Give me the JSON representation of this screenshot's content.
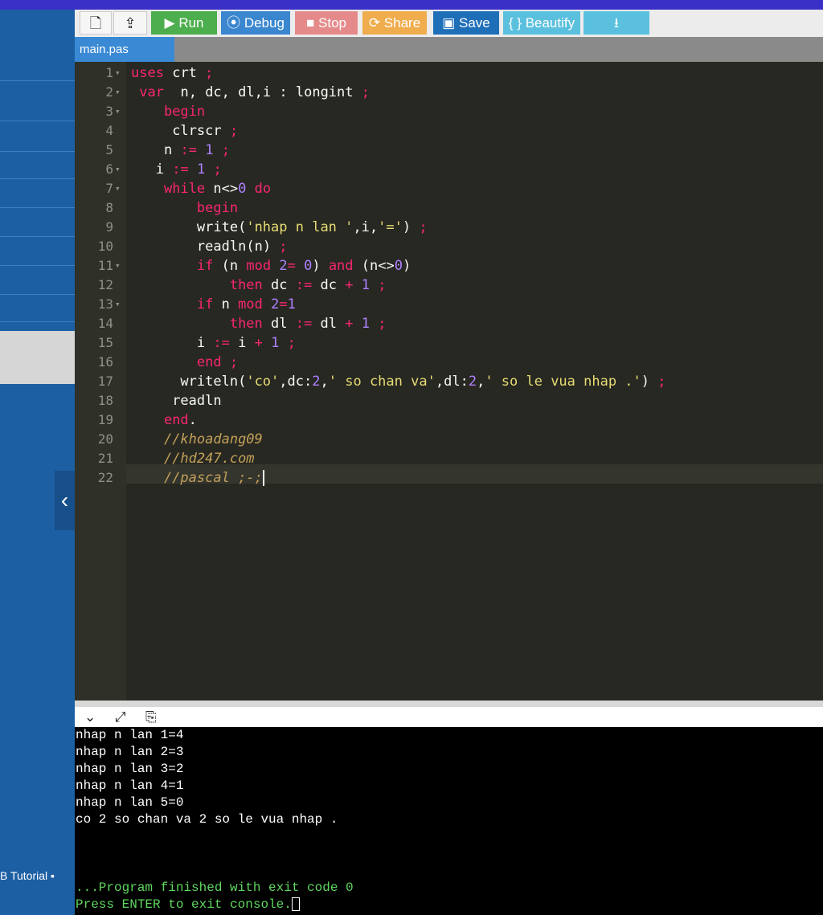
{
  "toolbar": {
    "buttons": [
      {
        "icon": "new-file-icon",
        "glyph": "🗋"
      },
      {
        "icon": "upload-icon",
        "glyph": "⇪"
      },
      {
        "label": "Run",
        "glyph": "▶"
      },
      {
        "label": "Debug",
        "glyph": "⦿"
      },
      {
        "label": "Stop",
        "glyph": "■"
      },
      {
        "label": "Share",
        "glyph": "⟳"
      },
      {
        "label": "Save",
        "glyph": "▣"
      },
      {
        "label": "Beautify",
        "glyph": "{ }"
      },
      {
        "icon": "download-icon",
        "glyph": "⭳"
      }
    ]
  },
  "tab": {
    "filename": "main.pas"
  },
  "sidebar": {
    "tutorial_label": "B Tutorial ▪",
    "collapse_glyph": "‹"
  },
  "editor": {
    "line_numbers": [
      "1",
      "2",
      "3",
      "4",
      "5",
      "6",
      "7",
      "8",
      "9",
      "10",
      "11",
      "12",
      "13",
      "14",
      "15",
      "16",
      "17",
      "18",
      "19",
      "20",
      "21",
      "22"
    ],
    "lines": [
      "uses crt ;",
      " var  n, dc, dl,i : longint ;",
      "    begin",
      "     clrscr ;",
      "    n := 1 ;",
      "   i := 1 ;",
      "    while n<>0 do",
      "        begin",
      "        write('nhap n lan ',i,'=') ;",
      "        readln(n) ;",
      "        if (n mod 2= 0) and (n<>0)",
      "            then dc := dc + 1 ;",
      "        if n mod 2=1",
      "            then dl := dl + 1 ;",
      "        i := i + 1 ;",
      "        end ;",
      "      writeln('co',dc:2,' so chan va',dl:2,' so le vua nhap .') ;",
      "     readln",
      "    end.",
      "    //khoadang09",
      "    //hd247.com",
      "    //pascal ;-;"
    ]
  },
  "console": {
    "lines": [
      "nhap n lan 1=4",
      "nhap n lan 2=3",
      "nhap n lan 3=2",
      "nhap n lan 4=1",
      "nhap n lan 5=0",
      "co 2 so chan va 2 so le vua nhap .",
      "",
      "",
      "",
      "...Program finished with exit code 0",
      "Press ENTER to exit console."
    ]
  },
  "colors": {
    "sidebar": "#1d5fa3",
    "editor_bg": "#272822",
    "run": "#4cae4c",
    "debug": "#3a86cf",
    "stop": "#e58a8a",
    "share": "#f0ad4e",
    "save": "#1f6fb8",
    "beautify": "#5bc0de"
  }
}
